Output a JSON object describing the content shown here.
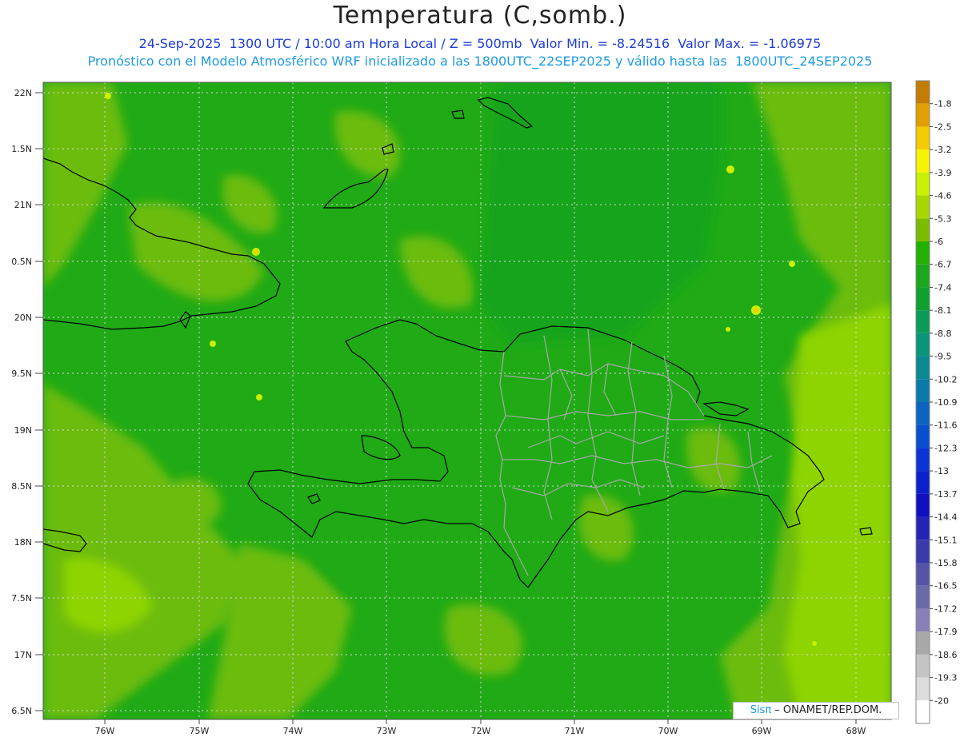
{
  "header": {
    "title": "Temperatura (C,somb.)",
    "line1": "24-Sep-2025  1300 UTC / 10:00 am Hora Local / Z = 500mb  Valor Min. = -8.24516  Valor Max. = -1.06975",
    "line2": "Pronóstico con el Modelo Atmosférico WRF inicializado a las 1800UTC_22SEP2025 y válido hasta las  1800UTC_24SEP2025"
  },
  "axes": {
    "lat_labels": [
      "22N",
      "1.5N",
      "21N",
      "0.5N",
      "20N",
      "9.5N",
      "19N",
      "8.5N",
      "18N",
      "7.5N",
      "17N",
      "6.5N"
    ],
    "lon_labels": [
      "76W",
      "75W",
      "74W",
      "73W",
      "72W",
      "71W",
      "70W",
      "69W",
      "68W"
    ]
  },
  "colorbar": {
    "labels": [
      "-1.8",
      "-2.5",
      "-3.2",
      "-3.9",
      "-4.6",
      "-5.3",
      "-6",
      "-6.7",
      "-7.4",
      "-8.1",
      "-8.8",
      "-9.5",
      "-10.2",
      "-10.9",
      "-11.6",
      "-12.3",
      "-13",
      "-13.7",
      "-14.4",
      "-15.1",
      "-15.8",
      "-16.5",
      "-17.2",
      "-17.9",
      "-18.6",
      "-19.3",
      "-20"
    ],
    "colors": [
      "#c47c00",
      "#e0a000",
      "#f2cc00",
      "#f6f200",
      "#c8f000",
      "#a6d800",
      "#7cbc00",
      "#24b000",
      "#1ca81c",
      "#10a030",
      "#0c9a58",
      "#0a9478",
      "#0a8a90",
      "#0a7aa8",
      "#0a64c0",
      "#0a4ed0",
      "#0a34d4",
      "#0a20c8",
      "#1010c0",
      "#2424b4",
      "#3a3aaa",
      "#5454a8",
      "#6a6aa8",
      "#8a80b8",
      "#a8a8a8",
      "#c4c4c4",
      "#dcdcdc",
      "#ffffff"
    ]
  },
  "credit": {
    "brand": "Sisπ",
    "text": " – ONAMET/REP.DOM."
  },
  "colors": {
    "base_field": "#1faa16",
    "warm_field": "#6cbc0c",
    "warmer_field": "#8ed400",
    "coast": "#000000",
    "provinces": "#a8a8a8"
  }
}
